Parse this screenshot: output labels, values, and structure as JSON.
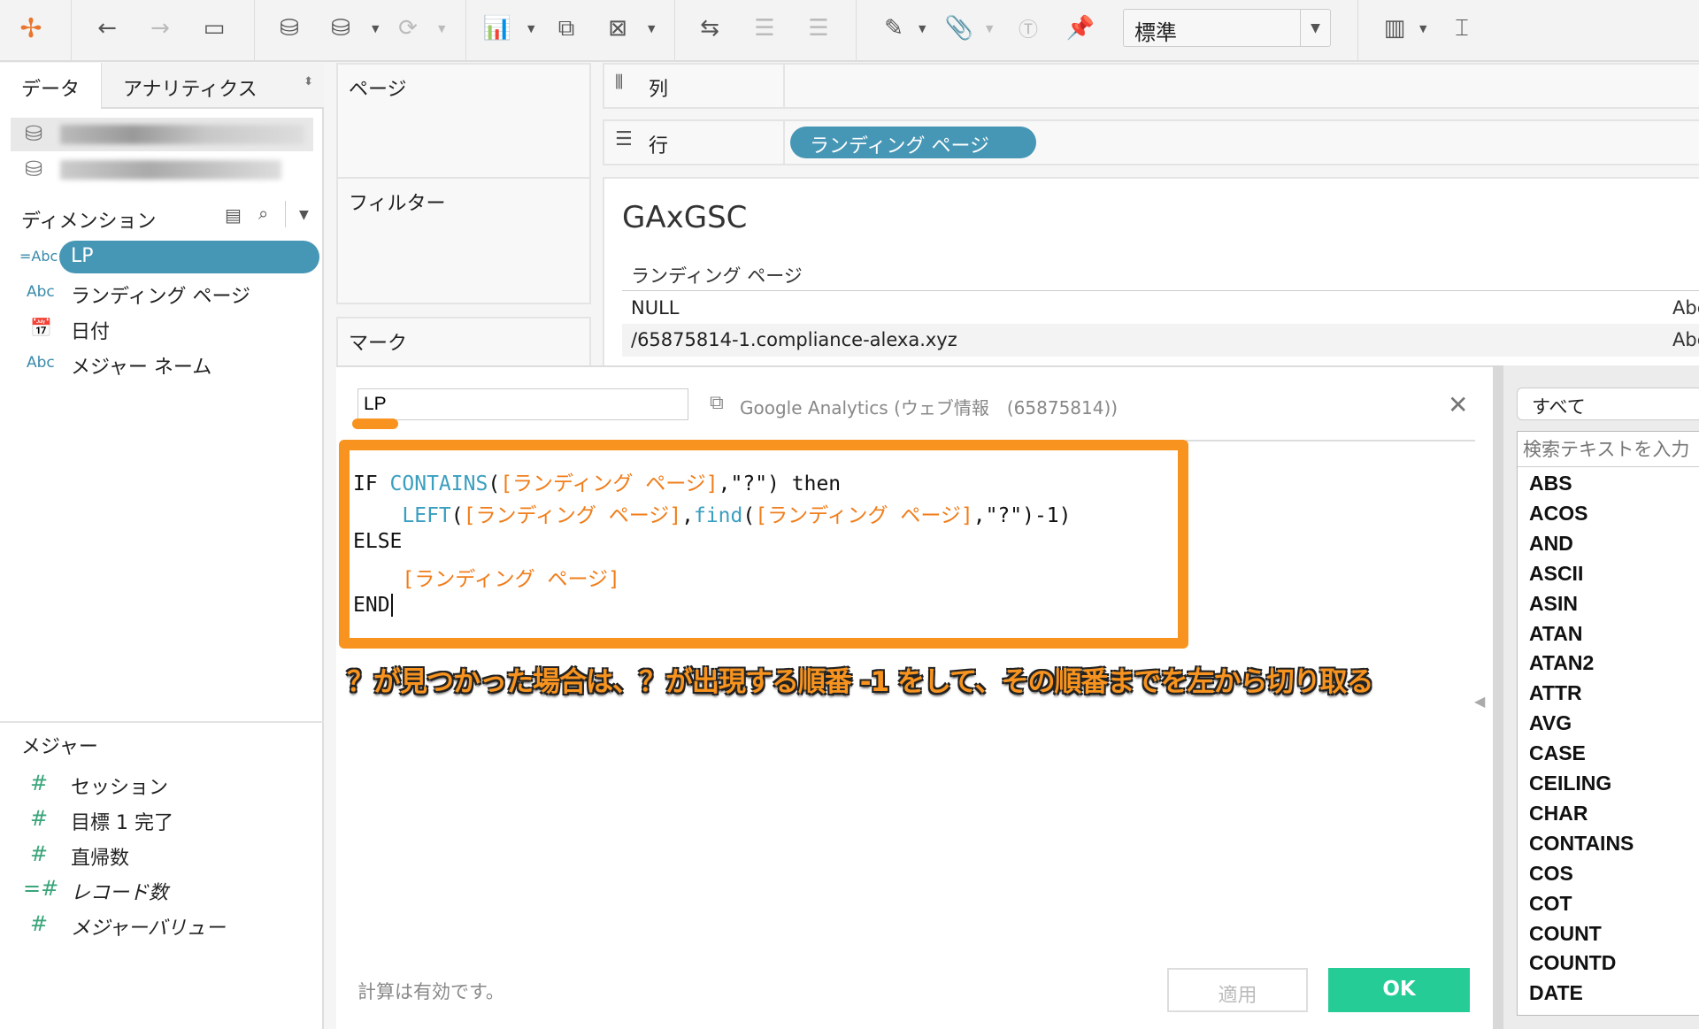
{
  "toolbar": {
    "icons": [
      "tableau-logo-icon",
      "back-icon",
      "forward-icon",
      "save-icon",
      "new-data-source-icon",
      "pause-auto-update-icon",
      "refresh-icon",
      "new-worksheet-icon",
      "duplicate-sheet-icon",
      "clear-sheet-icon",
      "swap-rows-columns-icon",
      "sort-ascending-icon",
      "sort-descending-icon",
      "highlight-icon",
      "group-members-icon",
      "show-mark-labels-icon",
      "fix-axes-icon",
      "show-me-icon",
      "presentation-mode-icon"
    ],
    "fit_value": "標準"
  },
  "left_panel": {
    "tabs": [
      {
        "label": "データ",
        "active": true
      },
      {
        "label": "アナリティクス",
        "active": false
      }
    ],
    "dimensions_title": "ディメンション",
    "dimensions": [
      {
        "type": "=Abc",
        "label": "LP",
        "selected": true
      },
      {
        "type": "Abc",
        "label": "ランディング ページ"
      },
      {
        "type": "date",
        "label": "日付"
      },
      {
        "type": "Abc",
        "label": "メジャー ネーム"
      }
    ],
    "measures_title": "メジャー",
    "measures": [
      {
        "type": "#",
        "label": "セッション"
      },
      {
        "type": "#",
        "label": "目標 1 完了"
      },
      {
        "type": "#",
        "label": "直帰数"
      },
      {
        "type": "=#",
        "label": "レコード数"
      },
      {
        "type": "#",
        "label": "メジャーバリュー"
      }
    ]
  },
  "cards": {
    "pages": "ページ",
    "filters": "フィルター",
    "marks": "マーク"
  },
  "shelves": {
    "columns": "列",
    "rows": "行",
    "rows_pill": "ランディング ページ"
  },
  "viz": {
    "title": "GAxGSC",
    "header": "ランディング ページ",
    "rows": [
      {
        "value": "NULL",
        "tag": "Abc"
      },
      {
        "value": "/65875814-1.compliance-alexa.xyz",
        "tag": "Abc"
      }
    ]
  },
  "calc_dialog": {
    "name": "LP",
    "datasource": "Google Analytics (ウェブ情報　(65875814))",
    "code": [
      [
        {
          "t": "kw",
          "v": "IF "
        },
        {
          "t": "fn",
          "v": "CONTAINS"
        },
        {
          "t": "txt",
          "v": "("
        },
        {
          "t": "field",
          "v": "[ランディング ページ]"
        },
        {
          "t": "txt",
          "v": ",\"?\") then"
        }
      ],
      [
        {
          "t": "txt",
          "v": "    "
        },
        {
          "t": "fn",
          "v": "LEFT"
        },
        {
          "t": "txt",
          "v": "("
        },
        {
          "t": "field",
          "v": "[ランディング ページ]"
        },
        {
          "t": "txt",
          "v": ","
        },
        {
          "t": "fn",
          "v": "find"
        },
        {
          "t": "txt",
          "v": "("
        },
        {
          "t": "field",
          "v": "[ランディング ページ]"
        },
        {
          "t": "txt",
          "v": ",\"?\")-1)"
        }
      ],
      [
        {
          "t": "kw",
          "v": "ELSE"
        }
      ],
      [
        {
          "t": "txt",
          "v": "    "
        },
        {
          "t": "field",
          "v": "[ランディング ページ]"
        }
      ],
      [
        {
          "t": "kw",
          "v": "END"
        }
      ]
    ],
    "annotation": "？が見つかった場合は、？が出現する順番 -1 をして、その順番までを左から切り取る",
    "status": "計算は有効です。",
    "apply_label": "適用",
    "ok_label": "OK",
    "colors": {
      "annotation": "#f7931e",
      "ok": "#26cc96",
      "pill": "#4696b5"
    }
  },
  "functions": {
    "filter": "すべて",
    "search_placeholder": "検索テキストを入力",
    "items": [
      "ABS",
      "ACOS",
      "AND",
      "ASCII",
      "ASIN",
      "ATAN",
      "ATAN2",
      "ATTR",
      "AVG",
      "CASE",
      "CEILING",
      "CHAR",
      "CONTAINS",
      "COS",
      "COT",
      "COUNT",
      "COUNTD",
      "DATE"
    ]
  }
}
